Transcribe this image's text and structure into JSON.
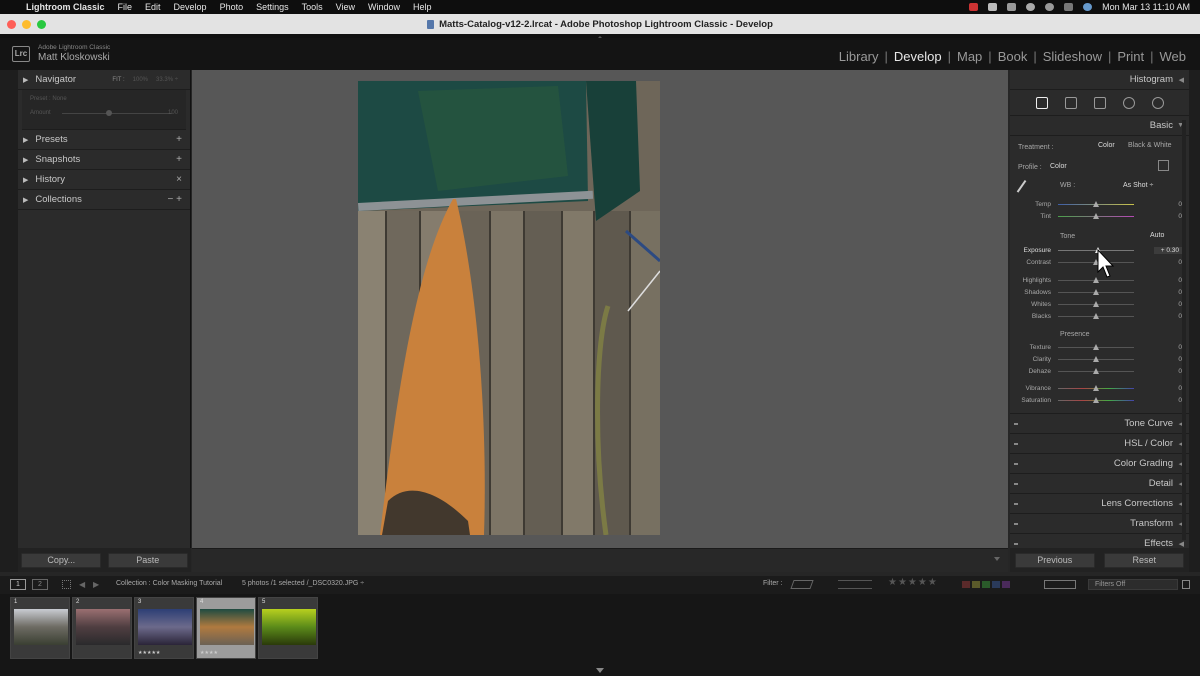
{
  "menubar": {
    "app": "Lightroom Classic",
    "items": [
      "File",
      "Edit",
      "Develop",
      "Photo",
      "Settings",
      "Tools",
      "View",
      "Window",
      "Help"
    ],
    "clock": "Mon Mar 13  11:10 AM"
  },
  "window": {
    "title": "Matts-Catalog-v12-2.lrcat - Adobe Photoshop Lightroom Classic - Develop"
  },
  "identity": {
    "badge": "Lrc",
    "product": "Adobe Lightroom Classic",
    "user": "Matt Kloskowski"
  },
  "modules": {
    "items": [
      "Library",
      "Develop",
      "Map",
      "Book",
      "Slideshow",
      "Print",
      "Web"
    ],
    "active": "Develop"
  },
  "left_panel": {
    "navigator": {
      "label": "Navigator",
      "zoom_fit": "FIT :",
      "zoom_100": "100%",
      "zoom_custom": "33.3% ÷"
    },
    "preset_amount": {
      "preset_label": "Preset : None",
      "amount_label": "Amount",
      "amount_value": "100"
    },
    "sections": [
      {
        "label": "Presets",
        "action": "+"
      },
      {
        "label": "Snapshots",
        "action": "+"
      },
      {
        "label": "History",
        "action": "×"
      },
      {
        "label": "Collections",
        "action": "− +"
      }
    ],
    "copy_button": "Copy...",
    "paste_button": "Paste"
  },
  "right_panel": {
    "histogram": "Histogram",
    "basic": {
      "title": "Basic",
      "treatment_label": "Treatment :",
      "treatment_color": "Color",
      "treatment_bw": "Black & White",
      "profile_label": "Profile :",
      "profile_value": "Color",
      "wb_label": "WB :",
      "wb_value": "As Shot ÷",
      "wb_sliders": [
        {
          "label": "Temp",
          "value": "0",
          "pos": 0.5
        },
        {
          "label": "Tint",
          "value": "0",
          "pos": 0.5
        }
      ],
      "tone_label": "Tone",
      "auto_label": "Auto",
      "tone_sliders": [
        {
          "label": "Exposure",
          "value": "+ 0.30",
          "pos": 0.53
        },
        {
          "label": "Contrast",
          "value": "0",
          "pos": 0.5
        },
        {
          "label": "Highlights",
          "value": "0",
          "pos": 0.5
        },
        {
          "label": "Shadows",
          "value": "0",
          "pos": 0.5
        },
        {
          "label": "Whites",
          "value": "0",
          "pos": 0.5
        },
        {
          "label": "Blacks",
          "value": "0",
          "pos": 0.5
        }
      ],
      "presence_label": "Presence",
      "presence_sliders": [
        {
          "label": "Texture",
          "value": "0",
          "pos": 0.5
        },
        {
          "label": "Clarity",
          "value": "0",
          "pos": 0.5
        },
        {
          "label": "Dehaze",
          "value": "0",
          "pos": 0.5
        },
        {
          "label": "Vibrance",
          "value": "0",
          "pos": 0.5
        },
        {
          "label": "Saturation",
          "value": "0",
          "pos": 0.5
        }
      ]
    },
    "collapsed": [
      "Tone Curve",
      "HSL / Color",
      "Color Grading",
      "Detail",
      "Lens Corrections",
      "Transform",
      "Effects"
    ],
    "previous_button": "Previous",
    "reset_button": "Reset"
  },
  "filmstrip_bar": {
    "screen1": "1",
    "screen2": "2",
    "collection": "Collection : Color Masking Tutorial",
    "count": "5 photos /1 selected /_DSC0320.JPG ÷",
    "filter_label": "Filter :",
    "filters_off": "Filters Off"
  },
  "filmstrip": {
    "thumbs": [
      {
        "n": "1",
        "stars": "",
        "colors": [
          "#c9ccd2",
          "#6d6b63",
          "#3a3f32"
        ]
      },
      {
        "n": "2",
        "stars": "",
        "colors": [
          "#9a6f71",
          "#4f3e41",
          "#2a2a2c"
        ]
      },
      {
        "n": "3",
        "stars": "★★★★★",
        "colors": [
          "#2d3f75",
          "#6c6a8b",
          "#2a2438"
        ]
      },
      {
        "n": "4",
        "stars": "★★★★",
        "colors": [
          "#1f4b41",
          "#b07a3f",
          "#6b6154"
        ]
      },
      {
        "n": "5",
        "stars": "",
        "colors": [
          "#b8d01f",
          "#5b8b1a",
          "#2a3a0a"
        ]
      }
    ],
    "selected_index": 3
  }
}
